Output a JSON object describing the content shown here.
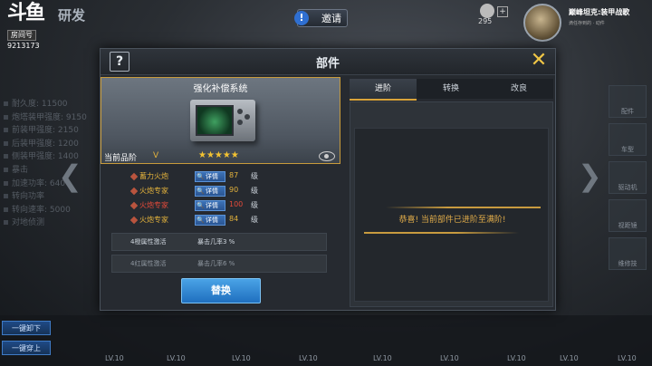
{
  "header": {
    "logo_mark": "斗鱼",
    "room_label": "房间号",
    "room_id": "9213173",
    "section_title": "研发",
    "invite_icon": "!",
    "invite_label": "邀请",
    "currency_count": "295",
    "plus_label": "+",
    "tank_name": "巅峰坦克:装甲战歌",
    "tank_subtitle": "滴任存到的 · 动件"
  },
  "background": {
    "left_stats": [
      "耐久度: 11500",
      "炮塔装甲强度: 9150",
      "前装甲强度: 2150",
      "后装甲强度: 1200",
      "侧装甲强度: 1400",
      "暴击",
      "加速功率: 640",
      "转向功率",
      "转向速率: 5000",
      "对地侦测"
    ],
    "bottom_buttons": [
      "一键卸下",
      "一键穿上"
    ],
    "levels": [
      "LV.10",
      "LV.10",
      "LV.10",
      "LV.10",
      "LV.10",
      "LV.10",
      "LV.10",
      "LV.10",
      "LV.10"
    ],
    "rail_items": [
      "配件",
      "车型",
      "驱动机",
      "视距镜",
      "维修技"
    ]
  },
  "dialog": {
    "title": "部件",
    "help_icon": "?",
    "close_icon": "✕",
    "part_name": "强化补偿系统",
    "grade_label": "当前品阶",
    "grade_value": "V",
    "stars": "★★★★★",
    "attributes": [
      {
        "name": "蓄力火炮",
        "detail": "详情",
        "value": "87",
        "unit": "级",
        "color": "#e3b23c"
      },
      {
        "name": "火炮专家",
        "detail": "详情",
        "value": "90",
        "unit": "级",
        "color": "#e3b23c"
      },
      {
        "name": "火炮专家",
        "detail": "详情",
        "value": "100",
        "unit": "级",
        "color": "#e44a3a"
      },
      {
        "name": "火炮专家",
        "detail": "详情",
        "value": "84",
        "unit": "级",
        "color": "#e3b23c"
      }
    ],
    "activations": [
      {
        "key": "4橙属性激活",
        "value": "暴击几率3 %"
      },
      {
        "key": "4红属性激活",
        "value": "暴击几率6 %"
      }
    ],
    "replace_label": "替换",
    "tabs": [
      "进阶",
      "转换",
      "改良"
    ],
    "active_tab": "进阶",
    "message": "恭喜! 当前部件已进阶至满阶!"
  }
}
